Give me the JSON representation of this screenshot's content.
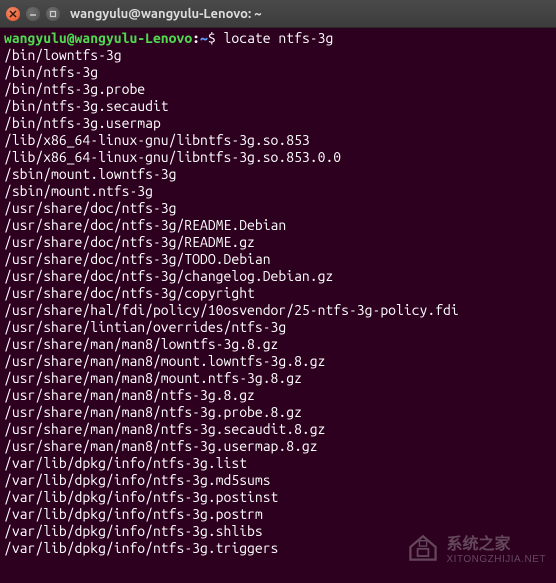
{
  "window": {
    "title": "wangyulu@wangyulu-Lenovo: ~"
  },
  "prompt": {
    "user_host": "wangyulu@wangyulu-Lenovo",
    "separator": ":",
    "path": "~",
    "symbol": "$"
  },
  "command": "locate ntfs-3g",
  "output": [
    "/bin/lowntfs-3g",
    "/bin/ntfs-3g",
    "/bin/ntfs-3g.probe",
    "/bin/ntfs-3g.secaudit",
    "/bin/ntfs-3g.usermap",
    "/lib/x86_64-linux-gnu/libntfs-3g.so.853",
    "/lib/x86_64-linux-gnu/libntfs-3g.so.853.0.0",
    "/sbin/mount.lowntfs-3g",
    "/sbin/mount.ntfs-3g",
    "/usr/share/doc/ntfs-3g",
    "/usr/share/doc/ntfs-3g/README.Debian",
    "/usr/share/doc/ntfs-3g/README.gz",
    "/usr/share/doc/ntfs-3g/TODO.Debian",
    "/usr/share/doc/ntfs-3g/changelog.Debian.gz",
    "/usr/share/doc/ntfs-3g/copyright",
    "/usr/share/hal/fdi/policy/10osvendor/25-ntfs-3g-policy.fdi",
    "/usr/share/lintian/overrides/ntfs-3g",
    "/usr/share/man/man8/lowntfs-3g.8.gz",
    "/usr/share/man/man8/mount.lowntfs-3g.8.gz",
    "/usr/share/man/man8/mount.ntfs-3g.8.gz",
    "/usr/share/man/man8/ntfs-3g.8.gz",
    "/usr/share/man/man8/ntfs-3g.probe.8.gz",
    "/usr/share/man/man8/ntfs-3g.secaudit.8.gz",
    "/usr/share/man/man8/ntfs-3g.usermap.8.gz",
    "/var/lib/dpkg/info/ntfs-3g.list",
    "/var/lib/dpkg/info/ntfs-3g.md5sums",
    "/var/lib/dpkg/info/ntfs-3g.postinst",
    "/var/lib/dpkg/info/ntfs-3g.postrm",
    "/var/lib/dpkg/info/ntfs-3g.shlibs",
    "/var/lib/dpkg/info/ntfs-3g.triggers"
  ],
  "watermark": {
    "cn": "系统之家",
    "url": "XITONGZHIJIA.NET"
  }
}
